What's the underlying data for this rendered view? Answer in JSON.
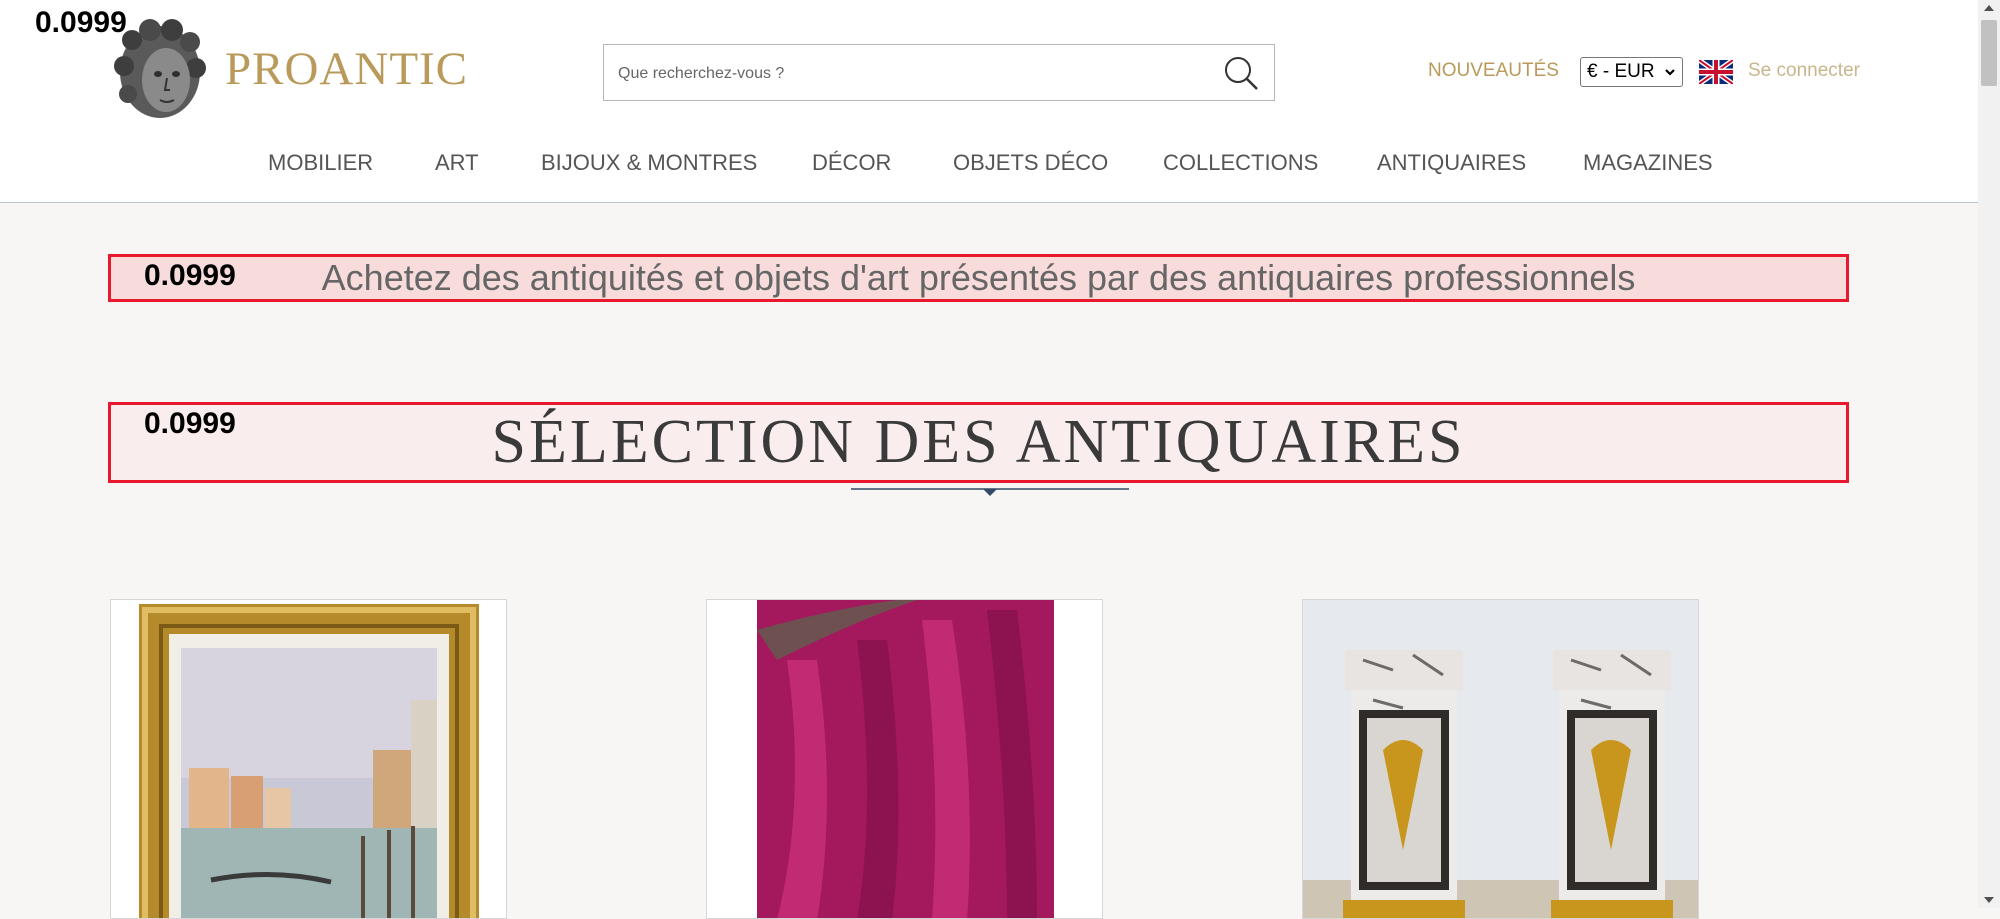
{
  "overlay_score": "0.0999",
  "header": {
    "logo_text": "PROANTIC",
    "search_placeholder": "Que recherchez-vous ?",
    "nouveautes": "NOUVEAUTÉS",
    "currency": "€ - EUR",
    "login": "Se connecter"
  },
  "nav": [
    "MOBILIER",
    "ART",
    "BIJOUX & MONTRES",
    "DÉCOR",
    "OBJETS DÉCO",
    "COLLECTIONS",
    "ANTIQUAIRES",
    "MAGAZINES"
  ],
  "tagline": "Achetez des antiquités et objets d'art présentés par des antiquaires professionnels",
  "section_title": "SÉLECTION DES ANTIQUAIRES",
  "colors": {
    "accent": "#b99a5b",
    "highlight_border": "#e8182d"
  }
}
